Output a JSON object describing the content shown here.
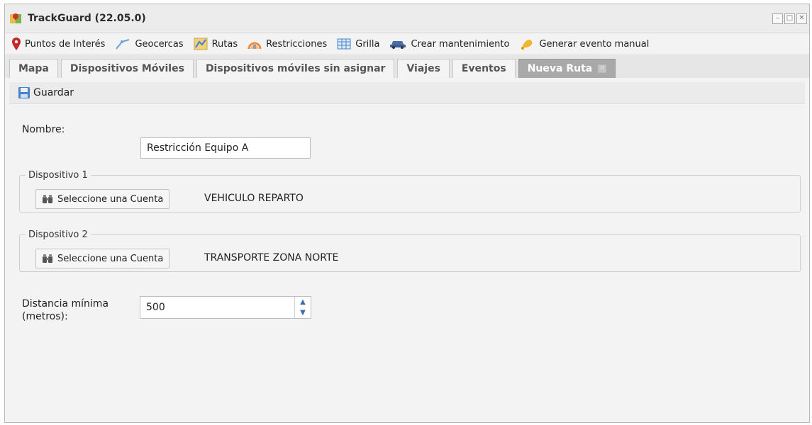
{
  "window": {
    "title": "TrackGuard (22.05.0)",
    "controls": [
      "minimize",
      "maximize",
      "close"
    ]
  },
  "toolbar": {
    "items": [
      {
        "label": "Puntos de Interés",
        "icon": "map-pin-icon"
      },
      {
        "label": "Geocercas",
        "icon": "geofence-icon"
      },
      {
        "label": "Rutas",
        "icon": "route-icon"
      },
      {
        "label": "Restricciones",
        "icon": "restriction-icon"
      },
      {
        "label": "Grilla",
        "icon": "grid-icon"
      },
      {
        "label": "Crear mantenimiento",
        "icon": "car-icon"
      },
      {
        "label": "Generar evento manual",
        "icon": "bell-icon"
      }
    ]
  },
  "tabs": [
    {
      "label": "Mapa",
      "active": false
    },
    {
      "label": "Dispositivos Móviles",
      "active": false
    },
    {
      "label": "Dispositivos móviles sin asignar",
      "active": false
    },
    {
      "label": "Viajes",
      "active": false
    },
    {
      "label": "Eventos",
      "active": false
    },
    {
      "label": "Nueva Ruta",
      "active": true,
      "closable": true
    }
  ],
  "form": {
    "save_label": "Guardar",
    "name_label": "Nombre:",
    "name_value": "Restricción Equipo A",
    "device1": {
      "legend": "Dispositivo 1",
      "button_label": "Seleccione una Cuenta",
      "value": "VEHICULO REPARTO"
    },
    "device2": {
      "legend": "Dispositivo 2",
      "button_label": "Seleccione una Cuenta",
      "value": "TRANSPORTE ZONA NORTE"
    },
    "distance_label_line1": "Distancia mínima",
    "distance_label_line2": "(metros):",
    "distance_value": "500"
  }
}
